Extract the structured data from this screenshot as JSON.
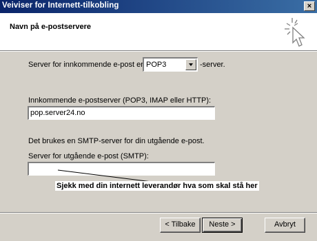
{
  "window": {
    "title": "Veiviser for Internett-tilkobling",
    "close_glyph": "×"
  },
  "header": {
    "heading": "Navn på e-postservere",
    "icon": "wizard-wand-icon"
  },
  "form": {
    "incoming_type_label_before": "Server for innkommende e-post er en",
    "incoming_type_value": "POP3",
    "incoming_type_label_after": "-server.",
    "incoming_server_label": "Innkommende e-postserver (POP3, IMAP eller HTTP):",
    "incoming_server_value": "pop.server24.no",
    "smtp_info": "Det brukes en SMTP-server for din utgående e-post.",
    "outgoing_server_label": "Server for utgående e-post (SMTP):",
    "outgoing_server_value": ""
  },
  "annotation": {
    "text": "Sjekk med din internett leverandør hva som skal stå her"
  },
  "buttons": {
    "back": "< Tilbake",
    "next": "Neste >",
    "cancel": "Avbryt"
  }
}
